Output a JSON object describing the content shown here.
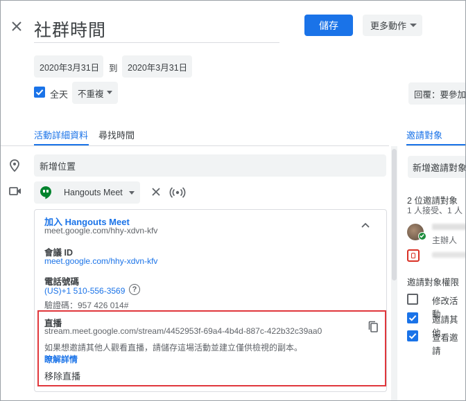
{
  "header": {
    "title": "社群時間",
    "save_label": "儲存",
    "more_actions_label": "更多動作"
  },
  "dates": {
    "start": "2020年3月31日",
    "separator": "到",
    "end": "2020年3月31日"
  },
  "options": {
    "all_day_label": "全天",
    "all_day_checked": true,
    "repeat_label": "不重複",
    "reply_label": "回覆：要參加"
  },
  "tabs": {
    "details": "活動詳細資料",
    "find_time": "尋找時間",
    "guests": "邀請對象"
  },
  "details": {
    "location_placeholder": "新增位置",
    "conference_label": "Hangouts Meet",
    "meet": {
      "join_label": "加入 Hangouts Meet",
      "join_url": "meet.google.com/hhy-xdvn-kfv",
      "meeting_id_label": "會議 ID",
      "meeting_id_link": "meet.google.com/hhy-xdvn-kfv",
      "phone_label": "電話號碼",
      "phone_number": "(US)+1 510-556-3569",
      "pin": "驗證碼：957 426 014#"
    },
    "live_stream": {
      "label": "直播",
      "url": "stream.meet.google.com/stream/4452953f-69a4-4b4d-887c-422b32c39aa0",
      "note": "如果想邀請其他人觀看直播，請儲存這場活動並建立僅供檢視的副本。",
      "learn_more": "瞭解詳情",
      "remove_label": "移除直播"
    }
  },
  "guests": {
    "add_placeholder": "新增邀請對象",
    "count_label": "2 位邀請對象",
    "status_label": "1 人接受、1 人",
    "organizer_label": "主辦人",
    "permissions_title": "邀請對象權限",
    "permissions": [
      {
        "label": "修改活動",
        "checked": false
      },
      {
        "label": "邀請其他",
        "checked": true
      },
      {
        "label": "查看邀請",
        "checked": true
      }
    ]
  },
  "colors": {
    "accent": "#1a73e8",
    "highlight_border": "#e0363b",
    "chip_bg": "#f1f3f4",
    "hangouts_green": "#00832d"
  }
}
